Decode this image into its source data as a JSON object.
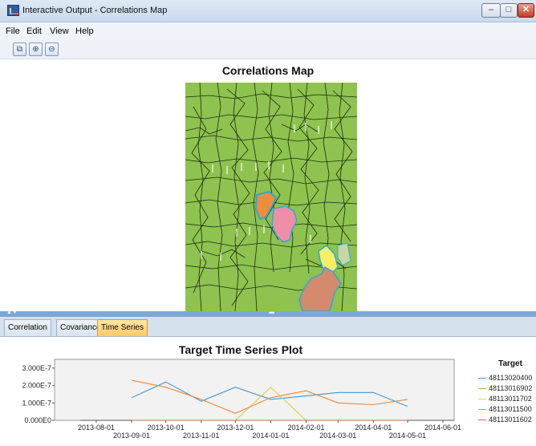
{
  "window": {
    "title": "Interactive Output - Correlations Map",
    "controls": {
      "minimize": "–",
      "maximize": "□",
      "close": "✕"
    }
  },
  "menu": [
    {
      "label": "File"
    },
    {
      "label": "Edit"
    },
    {
      "label": "View"
    },
    {
      "label": "Help"
    }
  ],
  "toolbar": [
    {
      "icon": "copy-icon",
      "glyph": "⧉"
    },
    {
      "icon": "zoom-in-icon",
      "glyph": "⊕"
    },
    {
      "icon": "zoom-out-icon",
      "glyph": "⊖"
    }
  ],
  "map": {
    "title": "Correlations Map",
    "colors": {
      "base": "#8dc34e",
      "border": "#1d2a16",
      "highlight_orange": "#ef8e3a",
      "highlight_pink": "#ef8fa7",
      "highlight_yellow": "#f8ee63",
      "highlight_tan": "#d48a6c",
      "highlight_outline": "#2aa9df"
    }
  },
  "splitter": {
    "arrows": "▲▼",
    "dots": "•••"
  },
  "tabs": [
    {
      "label": "Correlation",
      "active": false
    },
    {
      "label": "Covariance",
      "active": false
    },
    {
      "label": "Time Series",
      "active": true
    }
  ],
  "chart_data": {
    "type": "line",
    "title": "Target Time Series Plot",
    "xlabel": "",
    "ylabel": "",
    "x_ticks": [
      "2013-08-01",
      "2013-09-01",
      "2013-10-01",
      "2013-11-01",
      "2013-12-01",
      "2014-01-01",
      "2014-02-01",
      "2014-03-01",
      "2014-04-01",
      "2014-05-01",
      "2014-06-01"
    ],
    "y_ticks": [
      "0.000E0",
      "1.000E-7",
      "2.000E-7",
      "3.000E-7"
    ],
    "ylim": [
      0,
      3.5e-07
    ],
    "grid": false,
    "legend_title": "Target",
    "legend_position": "right",
    "series": [
      {
        "name": "48113020400",
        "color": "#3f97d4",
        "x": [
          "2013-09-01",
          "2013-10-01",
          "2013-11-01",
          "2013-12-01",
          "2014-01-01",
          "2014-02-01",
          "2014-03-01",
          "2014-04-01",
          "2014-05-01"
        ],
        "y": [
          1.3e-07,
          2.2e-07,
          1.1e-07,
          1.9e-07,
          1.2e-07,
          1.4e-07,
          1.6e-07,
          1.6e-07,
          8e-08
        ]
      },
      {
        "name": "48113016902",
        "color": "#8cbd50",
        "x": [
          "2013-09-01",
          "2013-10-01",
          "2013-11-01",
          "2013-12-01",
          "2014-01-01",
          "2014-02-01",
          "2014-03-01",
          "2014-04-01",
          "2014-05-01"
        ],
        "y": [
          0,
          0,
          0,
          0,
          0,
          0,
          0,
          0,
          0
        ]
      },
      {
        "name": "48113011702",
        "color": "#e6cd3c",
        "x": [
          "2013-09-01",
          "2013-10-01",
          "2013-11-01",
          "2013-12-01",
          "2014-01-01",
          "2014-02-01",
          "2014-03-01",
          "2014-04-01",
          "2014-05-01"
        ],
        "y": [
          0,
          0,
          0,
          0,
          1.9e-07,
          0,
          0,
          0,
          0
        ]
      },
      {
        "name": "48113011500",
        "color": "#e8883d",
        "x": [
          "2013-09-01",
          "2013-10-01",
          "2013-11-01",
          "2013-12-01",
          "2014-01-01",
          "2014-02-01",
          "2014-03-01",
          "2014-04-01",
          "2014-05-01"
        ],
        "y": [
          2.3e-07,
          1.9e-07,
          1.2e-07,
          4e-08,
          1.3e-07,
          1.7e-07,
          1e-07,
          9e-08,
          1.2e-07
        ]
      },
      {
        "name": "48113011602",
        "color": "#c96b45",
        "x": [
          "2013-09-01",
          "2013-10-01",
          "2013-11-01",
          "2013-12-01",
          "2014-01-01",
          "2014-02-01",
          "2014-03-01",
          "2014-04-01",
          "2014-05-01"
        ],
        "y": [
          0,
          0,
          0,
          0,
          0,
          0,
          0,
          0,
          0
        ]
      }
    ]
  }
}
